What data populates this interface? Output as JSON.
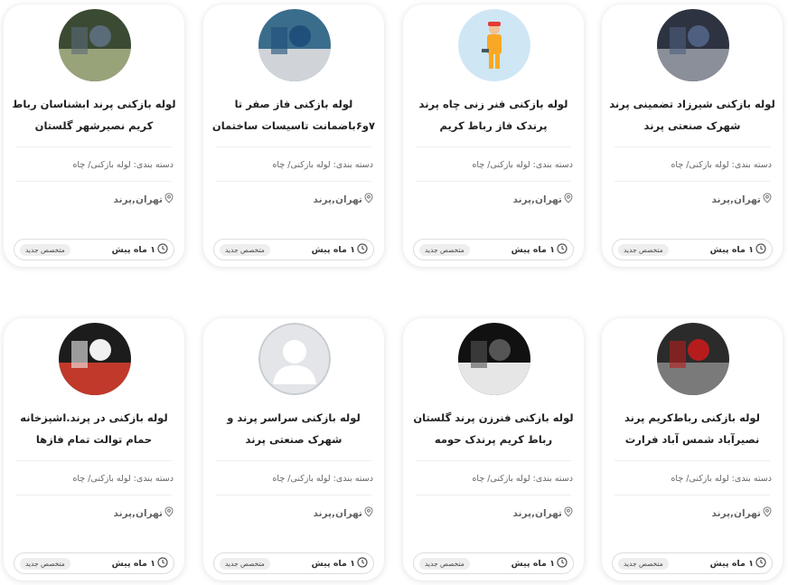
{
  "cards": [
    {
      "title": "لوله بازکنی شیرزاد تضمینی پرند شهرک صنعتی پرند",
      "category": "دسته بندی: لوله بازکنی/ چاه",
      "location": "تهران,پرند",
      "time": "۱ ماه پیش",
      "badge": "متخصص جدید",
      "avatar_icon": "photo-avatar"
    },
    {
      "title": "لوله بازکنی فنر زنی چاه پرند پرندک فاز رباط کریم",
      "category": "دسته بندی: لوله بازکنی/ چاه",
      "location": "تهران,پرند",
      "time": "۱ ماه پیش",
      "badge": "متخصص جدید",
      "avatar_icon": "plumber-avatar"
    },
    {
      "title": "لوله بازکنی فاز صفر تا ۷و۶باضمانت تاسیسات ساختمان",
      "category": "دسته بندی: لوله بازکنی/ چاه",
      "location": "تهران,پرند",
      "time": "۱ ماه پیش",
      "badge": "متخصص جدید",
      "avatar_icon": "photo-avatar"
    },
    {
      "title": "لوله بازکنی پرند ابشناسان رباط کریم نصیرشهر گلستان",
      "category": "دسته بندی: لوله بازکنی/ چاه",
      "location": "تهران,پرند",
      "time": "۱ ماه پیش",
      "badge": "متخصص جدید",
      "avatar_icon": "photo-avatar"
    },
    {
      "title": "لوله بازکنی رباط‌کریم پرند نصیرآباد شمس آباد فرارت",
      "category": "دسته بندی: لوله بازکنی/ چاه",
      "location": "تهران,پرند",
      "time": "۱ ماه پیش",
      "badge": "متخصص جدید",
      "avatar_icon": "photo-avatar"
    },
    {
      "title": "لوله بازکنی فنرزن پرند گلستان رباط کریم پرندک حومه",
      "category": "دسته بندی: لوله بازکنی/ چاه",
      "location": "تهران,پرند",
      "time": "۱ ماه پیش",
      "badge": "متخصص جدید",
      "avatar_icon": "photo-avatar"
    },
    {
      "title": "لوله بازکنی سراسر پرند و شهرک صنعتی پرند",
      "category": "دسته بندی: لوله بازکنی/ چاه",
      "location": "تهران,پرند",
      "time": "۱ ماه پیش",
      "badge": "متخصص جدید",
      "avatar_icon": "default-user-avatar"
    },
    {
      "title": "لوله بازکنی در پرند.اشپزخانه حمام توالت تمام فازها",
      "category": "دسته بندی: لوله بازکنی/ چاه",
      "location": "تهران,پرند",
      "time": "۱ ماه پیش",
      "badge": "متخصص جدید",
      "avatar_icon": "photo-avatar"
    }
  ]
}
